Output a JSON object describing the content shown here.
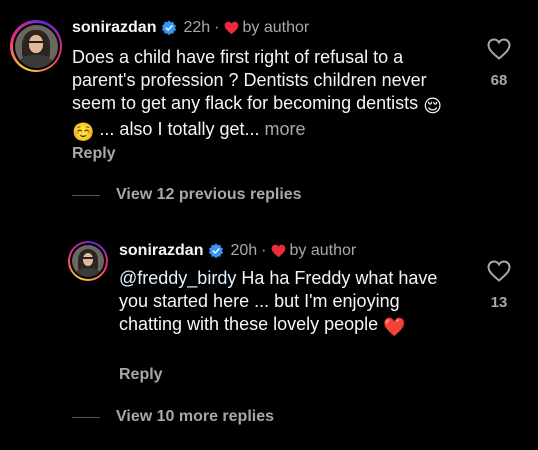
{
  "comments": [
    {
      "username": "sonirazdan",
      "time": "22h",
      "separator": "·",
      "author_badge": "by author",
      "text": "Does a child have first right of refusal to a parent's profession ? Dentists children never seem to get any flack for becoming dentists",
      "emoji_1": "😌",
      "emoji_2": "☺️",
      "text_tail": " ... also I totally get...",
      "more_label": "more",
      "reply_label": "Reply",
      "like_count": "68"
    },
    {
      "username": "sonirazdan",
      "time": "20h",
      "separator": "·",
      "author_badge": "by author",
      "mention": "@freddy_birdy",
      "text": " Ha ha Freddy what have you started here ... but I'm enjoying chatting with these lovely people",
      "emoji_1": "❤️",
      "reply_label": "Reply",
      "like_count": "13"
    }
  ],
  "view_previous_replies": "View 12 previous replies",
  "view_more_replies": "View 10 more replies",
  "colors": {
    "background": "#000000",
    "text": "#f5f5f5",
    "secondary": "#a8a8a8",
    "verified": "#3897f0",
    "heart": "#ed2b3c"
  },
  "icons": [
    "verified-badge-icon",
    "heart-icon",
    "like-heart-outline-icon"
  ]
}
